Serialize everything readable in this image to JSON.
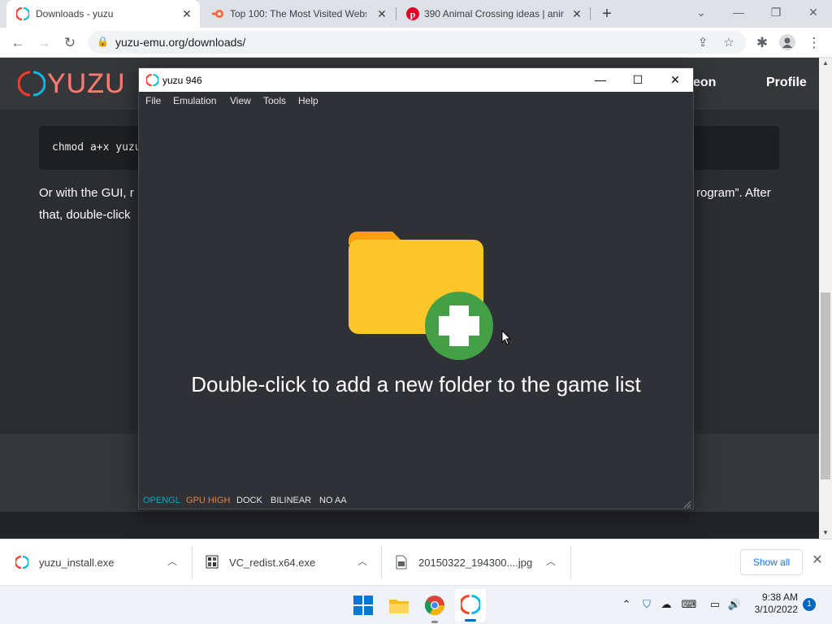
{
  "browser": {
    "tabs": [
      {
        "title": "Downloads - yuzu",
        "active": true
      },
      {
        "title": "Top 100: The Most Visited Websi",
        "active": false
      },
      {
        "title": "390 Animal Crossing ideas | anim",
        "active": false
      }
    ],
    "url": "yuzu-emu.org/downloads/"
  },
  "webpage": {
    "logo": "yuzu",
    "nav": {
      "patreon": "eon",
      "profile": "Profile"
    },
    "code": "chmod a+x yuzu",
    "para_line1_left": "Or with the GUI, r",
    "para_line1_right": "rogram”. After",
    "para_line2": "that, double-click"
  },
  "yuzu_window": {
    "title": "yuzu 946",
    "menu": [
      "File",
      "Emulation",
      "View",
      "Tools",
      "Help"
    ],
    "empty_message": "Double-click to add a new folder to the game list",
    "status": [
      {
        "label": "OPENGL",
        "color": "#00a9c4"
      },
      {
        "label": "GPU HIGH",
        "color": "#e0843c"
      },
      {
        "label": "DOCK",
        "color": "#e6e6e6"
      },
      {
        "label": "BILINEAR",
        "color": "#e6e6e6"
      },
      {
        "label": "NO AA",
        "color": "#e6e6e6"
      }
    ]
  },
  "downloads": {
    "items": [
      {
        "name": "yuzu_install.exe",
        "icon": "yuzu-icon"
      },
      {
        "name": "VC_redist.x64.exe",
        "icon": "installer-icon"
      },
      {
        "name": "20150322_194300....jpg",
        "icon": "image-file-icon"
      }
    ],
    "show_all": "Show all"
  },
  "taskbar": {
    "time": "9:38 AM",
    "date": "3/10/2022",
    "notifications": "1"
  },
  "colors": {
    "yuzu_red": "#ff3c28",
    "yuzu_cyan": "#0ab9e6",
    "folder": "#ffc629",
    "plus_green": "#43a047"
  }
}
